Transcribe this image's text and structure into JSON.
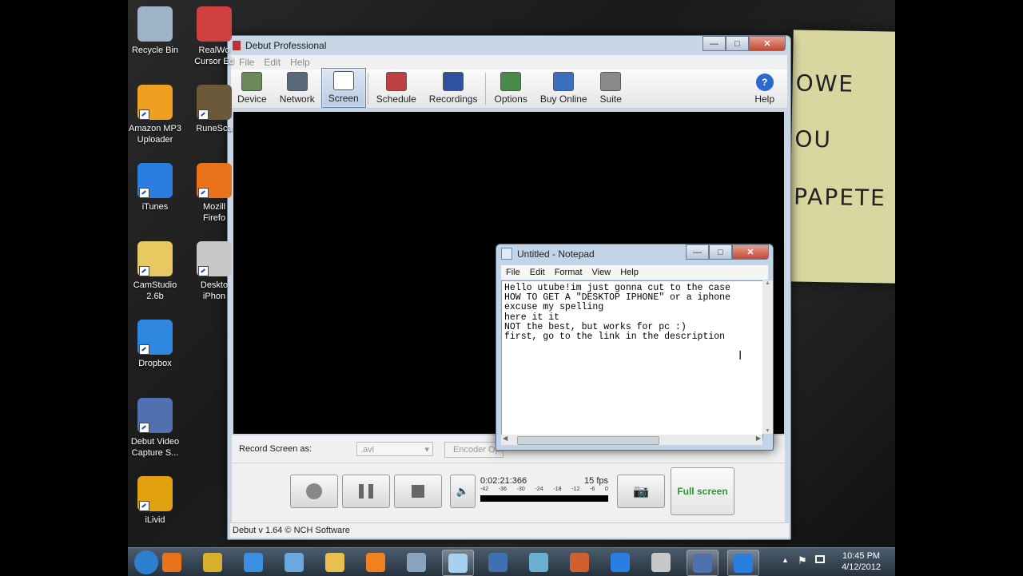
{
  "desktop": {
    "icons_col1": [
      {
        "label": "Recycle Bin",
        "icon": "recycle-bin-icon",
        "color": "#9fb3c8"
      },
      {
        "label": "Amazon MP3\nUploader",
        "icon": "amazon-mp3-icon",
        "color": "#f0a020"
      },
      {
        "label": "iTunes",
        "icon": "itunes-icon",
        "color": "#2a7de1"
      },
      {
        "label": "CamStudio\n2.6b",
        "icon": "folder-icon",
        "color": "#e8c860"
      },
      {
        "label": "Dropbox",
        "icon": "dropbox-icon",
        "color": "#2f88e0"
      },
      {
        "label": "Debut Video\nCapture S...",
        "icon": "debut-icon",
        "color": "#5070b0"
      },
      {
        "label": "iLivid",
        "icon": "ilivid-icon",
        "color": "#e0a010"
      }
    ],
    "icons_col2": [
      {
        "label": "RealWo\nCursor Ed",
        "icon": "realworld-cursor-icon",
        "color": "#d04040"
      },
      {
        "label": "RuneSca",
        "icon": "runescape-icon",
        "color": "#6b5a3a"
      },
      {
        "label": "Mozill\nFirefo",
        "icon": "firefox-icon",
        "color": "#e8731a"
      },
      {
        "label": "Deskto\niPhon",
        "icon": "apple-icon",
        "color": "#c8c8c8"
      }
    ],
    "sticky_words": [
      "OWE",
      "OU",
      "PAPETE"
    ]
  },
  "debut": {
    "title": "Debut Professional",
    "menu": [
      "File",
      "Edit",
      "Help"
    ],
    "toolbar": [
      {
        "label": "Device",
        "icon": "device-webcam-icon"
      },
      {
        "label": "Network",
        "icon": "network-icon"
      },
      {
        "label": "Screen",
        "icon": "screen-icon",
        "active": true
      },
      {
        "label": "Schedule",
        "icon": "schedule-icon"
      },
      {
        "label": "Recordings",
        "icon": "recordings-icon"
      },
      {
        "label": "Options",
        "icon": "options-icon"
      },
      {
        "label": "Buy Online",
        "icon": "buy-online-icon"
      },
      {
        "label": "Suite",
        "icon": "suite-icon"
      }
    ],
    "help_label": "Help",
    "record_label": "Record Screen as:",
    "format_value": ".avi",
    "encoder_label": "Encoder Op...",
    "timer": "0:02:21:366",
    "fps": "15 fps",
    "meter_ticks": [
      "-42",
      "-36",
      "-30",
      "-24",
      "-18",
      "-12",
      "-6",
      "0"
    ],
    "fullscreen_label": "Full screen",
    "status": "Debut v 1.64 © NCH Software"
  },
  "notepad": {
    "title": "Untitled - Notepad",
    "menu": [
      "File",
      "Edit",
      "Format",
      "View",
      "Help"
    ],
    "text": "Hello utube!im just gonna cut to the case\nHOW TO GET A \"DESKTOP IPHONE\" or a iphone\nexcuse my spelling\nhere it it\nNOT the best, but works for pc :)\nfirst, go to the link in the description"
  },
  "taskbar": {
    "time": "10:45 PM",
    "date": "4/12/2012",
    "items": [
      {
        "icon": "start-orb-icon",
        "color": "#2f7fd0",
        "open": false
      },
      {
        "icon": "firefox-icon",
        "color": "#e8731a",
        "open": false
      },
      {
        "icon": "chrome-icon",
        "color": "#d8b030",
        "open": false
      },
      {
        "icon": "internet-explorer-icon",
        "color": "#3a8fe0",
        "open": false
      },
      {
        "icon": "safari-icon",
        "color": "#6aa8e0",
        "open": false
      },
      {
        "icon": "explorer-folder-icon",
        "color": "#e8c050",
        "open": false
      },
      {
        "icon": "media-player-icon",
        "color": "#f08020",
        "open": false
      },
      {
        "icon": "calculator-icon",
        "color": "#8aa4c0",
        "open": false
      },
      {
        "icon": "notepad-icon",
        "color": "#a8d0f0",
        "open": true
      },
      {
        "icon": "remote-desktop-icon",
        "color": "#4070b0",
        "open": false
      },
      {
        "icon": "network-chat-icon",
        "color": "#6ab0d0",
        "open": false
      },
      {
        "icon": "paint-icon",
        "color": "#d06030",
        "open": false
      },
      {
        "icon": "itunes-icon",
        "color": "#2a7de1",
        "open": false
      },
      {
        "icon": "folder-window-icon",
        "color": "#c8c8c8",
        "open": false
      },
      {
        "icon": "debut-icon",
        "color": "#5070b0",
        "open": true
      },
      {
        "icon": "itunes-icon",
        "color": "#2a7de1",
        "open": true
      }
    ]
  }
}
